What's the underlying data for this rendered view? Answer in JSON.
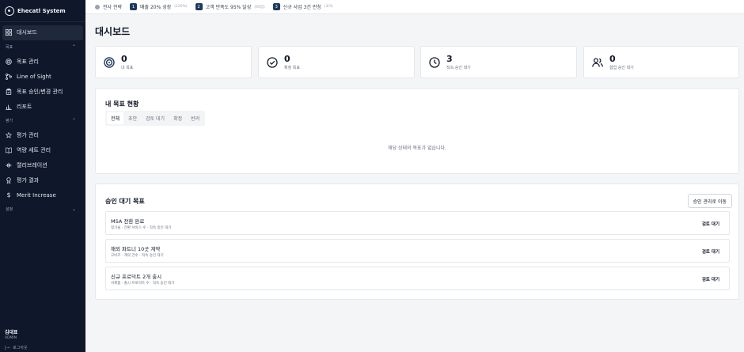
{
  "brand": {
    "name": "Ehecatl System"
  },
  "sidebar": {
    "top_items": [
      {
        "label": "대시보드",
        "icon": "grid-icon"
      }
    ],
    "sections": [
      {
        "label": "목표",
        "items": [
          {
            "label": "목표 관리",
            "icon": "target-icon"
          },
          {
            "label": "Line of Sight",
            "icon": "hierarchy-icon"
          },
          {
            "label": "목표 승인/변경 관리",
            "icon": "clipboard-icon"
          },
          {
            "label": "리포트",
            "icon": "bar-chart-icon"
          }
        ]
      },
      {
        "label": "평가",
        "items": [
          {
            "label": "평가 관리",
            "icon": "star-icon"
          },
          {
            "label": "역량 세트 관리",
            "icon": "book-icon"
          },
          {
            "label": "캘리브레이션",
            "icon": "sliders-icon"
          },
          {
            "label": "평가 결과",
            "icon": "award-icon"
          },
          {
            "label": "Merit Increase",
            "icon": "dollar-icon"
          }
        ]
      },
      {
        "label": "설정",
        "items": []
      }
    ],
    "user": {
      "name": "김대표",
      "role": "ADMIN"
    },
    "logout_label": "로그아웃"
  },
  "topbar": {
    "company_label": "전사 전략",
    "goals": [
      {
        "num": "1",
        "label": "매출 20% 성장",
        "pct": "(120%)"
      },
      {
        "num": "2",
        "label": "고객 만족도 95% 달성",
        "pct": "(95점)"
      },
      {
        "num": "3",
        "label": "신규 사업 3건 런칭",
        "pct": "(3/3)"
      }
    ]
  },
  "page": {
    "title": "대시보드"
  },
  "stats": [
    {
      "value": "0",
      "label": "내 목표",
      "icon": "target-icon"
    },
    {
      "value": "0",
      "label": "확정 목표",
      "icon": "check-circle-icon"
    },
    {
      "value": "3",
      "label": "직속 승인 대기",
      "icon": "clock-icon"
    },
    {
      "value": "0",
      "label": "협업 승인 대기",
      "icon": "users-icon"
    }
  ],
  "my_goals": {
    "title": "내 목표 현황",
    "tabs": [
      "전체",
      "초안",
      "검토 대기",
      "확정",
      "반려"
    ],
    "active_tab": "전체",
    "empty_text": "해당 상태의 목표가 없습니다."
  },
  "approvals": {
    "title": "승인 대기 목표",
    "button_label": "승인 관리로 이동",
    "rows": [
      {
        "title": "MSA 전환 완료",
        "sub": "정기술 · 전환 서비스 수 · 직속 승인 대기",
        "status": "검토 대기"
      },
      {
        "title": "해외 파트너 10곳 계약",
        "sub": "고비즈 · 계약 건수 · 직속 승인 대기",
        "status": "검토 대기"
      },
      {
        "title": "신규 프로덕트 2개 출시",
        "sub": "서제품 · 출시 프로덕트 수 · 직속 승인 대기",
        "status": "검토 대기"
      }
    ]
  },
  "colors": {
    "sidebar_bg": "#0f172a",
    "badge": "#1e3a5f",
    "page_bg": "#f4f5f7"
  }
}
